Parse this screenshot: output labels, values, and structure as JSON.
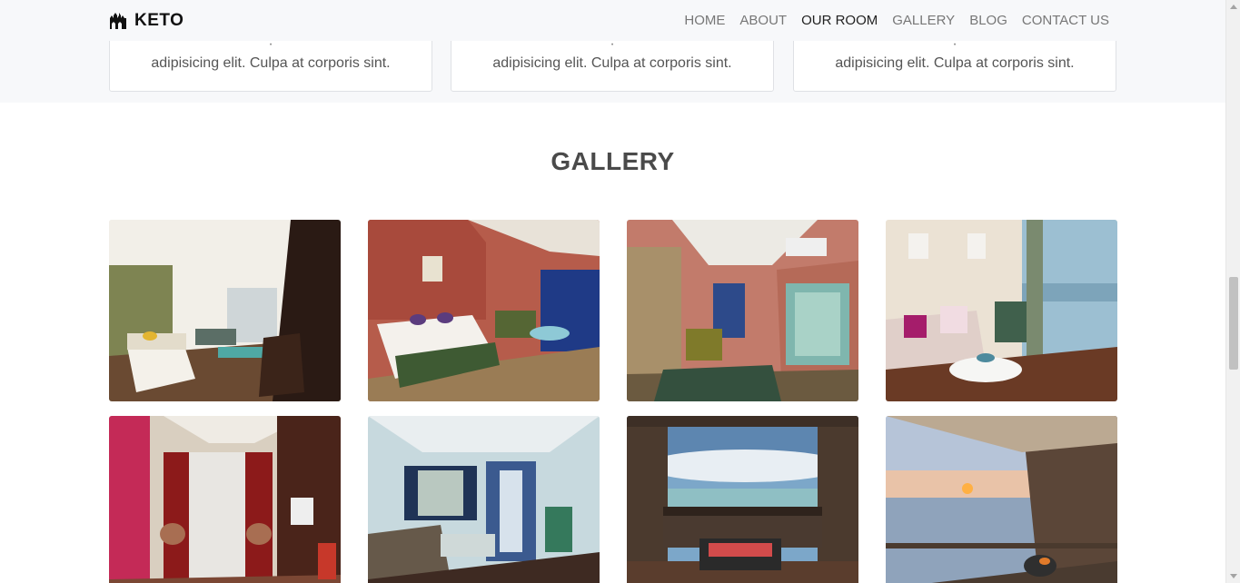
{
  "brand": {
    "name": "KETO",
    "icon": "castle-logo-icon"
  },
  "nav": {
    "items": [
      {
        "label": "HOME",
        "active": false
      },
      {
        "label": "ABOUT",
        "active": false
      },
      {
        "label": "OUR ROOM",
        "active": true
      },
      {
        "label": "GALLERY",
        "active": false
      },
      {
        "label": "BLOG",
        "active": false
      },
      {
        "label": "CONTACT US",
        "active": false
      }
    ]
  },
  "rooms": {
    "cards": [
      {
        "description": "adipisicing elit. Culpa at corporis sint."
      },
      {
        "description": "adipisicing elit. Culpa at corporis sint."
      },
      {
        "description": "adipisicing elit. Culpa at corporis sint."
      }
    ]
  },
  "gallery": {
    "title": "GALLERY",
    "images": [
      {
        "alt": "hotel bedroom with sofa"
      },
      {
        "alt": "bedroom with red walls and balcony"
      },
      {
        "alt": "room with glass bathroom"
      },
      {
        "alt": "living area with sea view"
      },
      {
        "alt": "room with red curtains"
      },
      {
        "alt": "blue room with sofa"
      },
      {
        "alt": "balcony with sea view"
      },
      {
        "alt": "balcony at sunset"
      }
    ]
  },
  "colors": {
    "top_bg": "#f7f8fa",
    "text_dark": "#222222",
    "text_muted": "#777777",
    "title": "#4a4a4a"
  }
}
